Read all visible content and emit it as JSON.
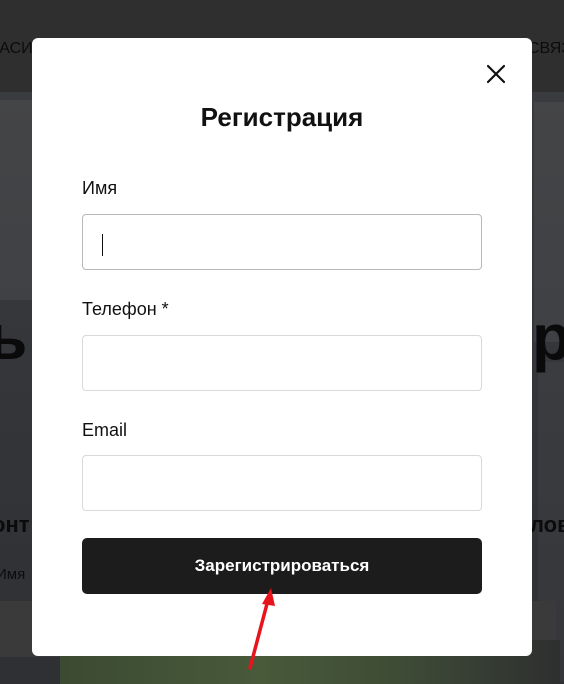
{
  "background": {
    "nav_left": "тасис",
    "nav_right": "связь",
    "hero_left": "ь",
    "hero_right": "ру",
    "section_left": "онт",
    "section_right": "лов",
    "field_label": "Имя"
  },
  "modal": {
    "title": "Регистрация",
    "fields": {
      "name": {
        "label": "Имя",
        "value": "",
        "placeholder": ""
      },
      "phone": {
        "label": "Телефон *",
        "value": "",
        "placeholder": ""
      },
      "email": {
        "label": "Email",
        "value": "",
        "placeholder": ""
      }
    },
    "submit_label": "Зарегистрироваться",
    "close_icon": "close-icon"
  },
  "colors": {
    "submit_bg": "#1c1c1c",
    "annotation_arrow": "#e8141c"
  }
}
